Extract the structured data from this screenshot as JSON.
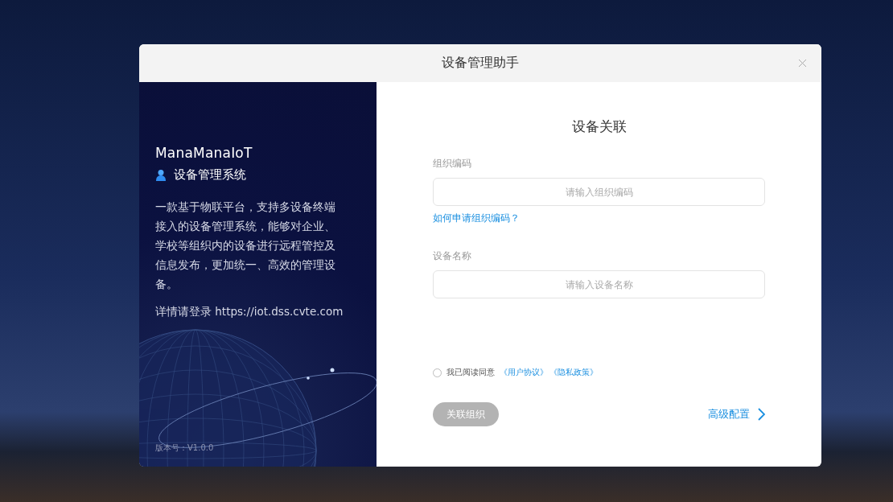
{
  "window": {
    "title": "设备管理助手"
  },
  "intro": {
    "brand": "ManaManaIoT",
    "product": "设备管理系统",
    "description": "一款基于物联平台，支持多设备终端接入的设备管理系统，能够对企业、学校等组织内的设备进行远程管控及信息发布，更加统一、高效的管理设备。",
    "login_hint": "详情请登录 https://iot.dss.cvte.com",
    "version": "版本号：V1.0.0"
  },
  "form": {
    "heading": "设备关联",
    "fields": [
      {
        "label": "组织编码",
        "placeholder": "请输入组织编码",
        "help_link": "如何申请组织编码？"
      },
      {
        "label": "设备名称",
        "placeholder": "请输入设备名称"
      }
    ],
    "agreement": {
      "checked": false,
      "text": "我已阅读同意",
      "links": [
        "《用户协议》",
        "《隐私政策》"
      ]
    },
    "submit": {
      "label": "关联组织",
      "disabled": true
    },
    "advanced": "高级配置"
  }
}
